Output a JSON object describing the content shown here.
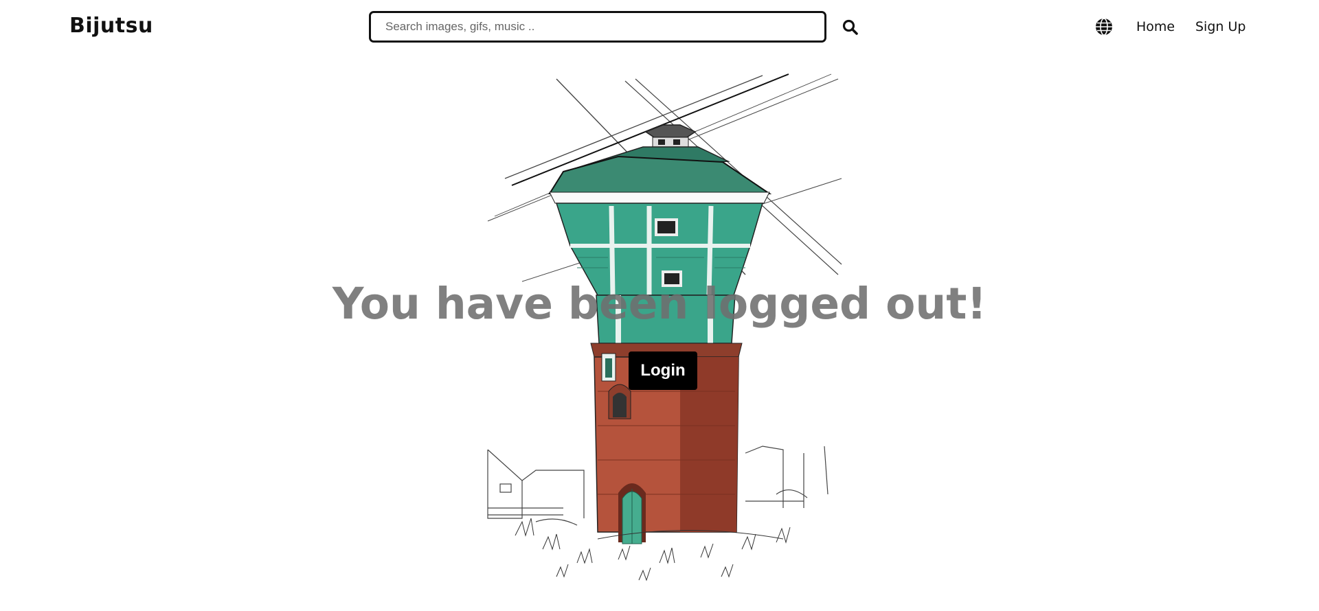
{
  "header": {
    "brand": "Bijutsu",
    "search": {
      "placeholder": "Search images, gifs, music ..",
      "value": ""
    },
    "nav": {
      "home_label": "Home",
      "signup_label": "Sign Up"
    }
  },
  "main": {
    "headline": "You have been logged out!",
    "login_label": "Login"
  },
  "icons": {
    "search": "search-icon",
    "language": "globe-icon"
  },
  "colors": {
    "headline": "#6e6e6e",
    "button_bg": "#000000",
    "button_text": "#ffffff",
    "tower_green": "#3aa58a",
    "tower_brick": "#b5533c"
  }
}
